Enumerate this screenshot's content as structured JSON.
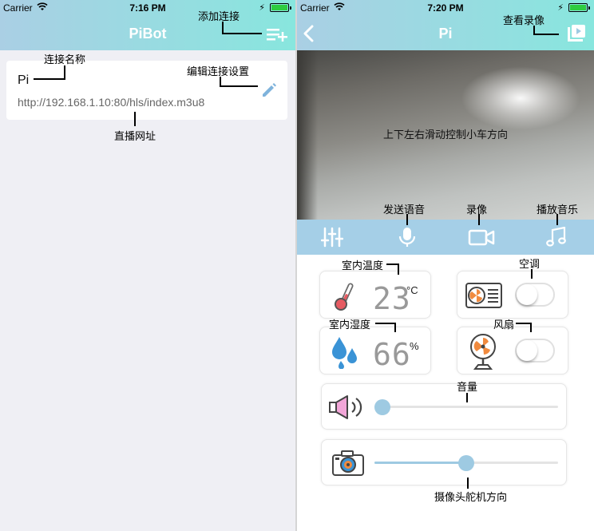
{
  "colors": {
    "navbar_start": "#aacfe4",
    "navbar_end": "#88e6de",
    "toolbar": "#a5cfe7",
    "accent": "#9ecae2"
  },
  "left_screen": {
    "status": {
      "carrier": "Carrier",
      "time": "7:16 PM"
    },
    "title": "PiBot",
    "connection": {
      "name": "Pi",
      "url": "http://192.168.1.10:80/hls/index.m3u8"
    },
    "annotations": {
      "add_connection": "添加连接",
      "connection_name": "连接名称",
      "edit_connection": "编辑连接设置",
      "stream_url": "直播网址"
    },
    "icons": {
      "add": "playlist-add-icon",
      "edit": "pencil-icon",
      "wifi": "wifi-icon",
      "battery": "battery-icon"
    }
  },
  "right_screen": {
    "status": {
      "carrier": "Carrier",
      "time": "7:20 PM"
    },
    "title": "Pi",
    "video_hint": "上下左右滑动控制小车方向",
    "toolbar_items": [
      "settings-sliders-icon",
      "microphone-icon",
      "video-camera-icon",
      "music-note-icon"
    ],
    "temperature": {
      "value": "23",
      "unit": "°C"
    },
    "humidity": {
      "value": "66",
      "unit": "%"
    },
    "air_conditioner": {
      "on": false
    },
    "fan": {
      "on": false
    },
    "volume": {
      "level": 0
    },
    "camera_servo": {
      "level": 0.5
    },
    "annotations": {
      "view_recordings": "查看录像",
      "send_voice": "发送语音",
      "record_video": "录像",
      "play_music": "播放音乐",
      "indoor_temperature": "室内温度",
      "air_conditioner": "空调",
      "indoor_humidity": "室内湿度",
      "fan": "风扇",
      "volume": "音量",
      "camera_servo_direction": "摄像头舵机方向"
    }
  }
}
